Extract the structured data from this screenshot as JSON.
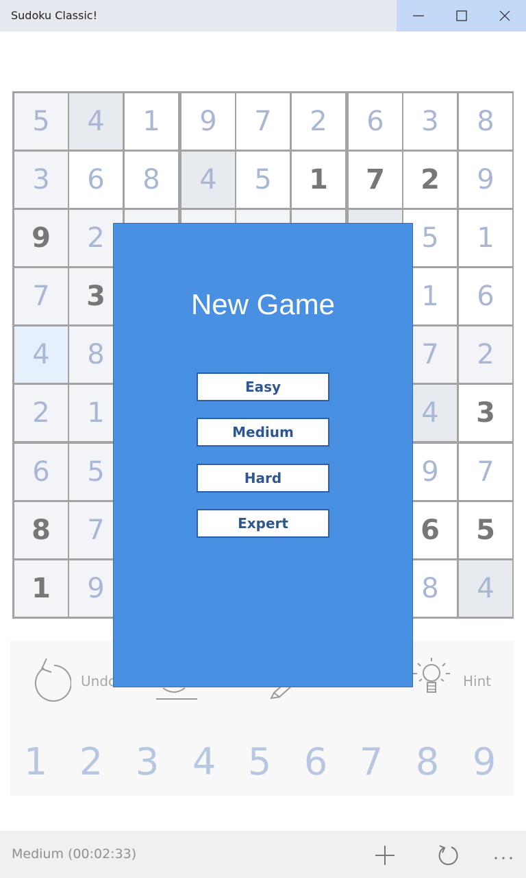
{
  "window": {
    "title": "Sudoku Classic!"
  },
  "board": {
    "rows": [
      [
        "5",
        "4",
        "1",
        "9",
        "7",
        "2",
        "6",
        "3",
        "8"
      ],
      [
        "3",
        "6",
        "8",
        "4",
        "5",
        "1",
        "7",
        "2",
        "9"
      ],
      [
        "9",
        "2",
        "",
        "",
        "",
        "",
        "",
        "5",
        "1"
      ],
      [
        "7",
        "3",
        "",
        "",
        "",
        "",
        "",
        "1",
        "6"
      ],
      [
        "4",
        "8",
        "",
        "",
        "",
        "",
        "",
        "7",
        "2"
      ],
      [
        "2",
        "1",
        "",
        "",
        "",
        "",
        "",
        "4",
        "3"
      ],
      [
        "6",
        "5",
        "",
        "",
        "",
        "",
        "",
        "9",
        "7"
      ],
      [
        "8",
        "7",
        "",
        "",
        "",
        "",
        "",
        "6",
        "5"
      ],
      [
        "1",
        "9",
        "",
        "",
        "",
        "",
        "",
        "8",
        "4"
      ]
    ],
    "given": [
      [
        0,
        0,
        0,
        0,
        0,
        0,
        0,
        0,
        0
      ],
      [
        0,
        0,
        0,
        0,
        0,
        1,
        1,
        1,
        0
      ],
      [
        1,
        0,
        0,
        0,
        0,
        0,
        0,
        0,
        0
      ],
      [
        0,
        1,
        0,
        0,
        0,
        0,
        0,
        0,
        0
      ],
      [
        0,
        0,
        0,
        0,
        0,
        0,
        0,
        0,
        0
      ],
      [
        0,
        0,
        0,
        0,
        0,
        0,
        0,
        0,
        1
      ],
      [
        0,
        0,
        0,
        0,
        0,
        0,
        0,
        0,
        0
      ],
      [
        1,
        0,
        0,
        0,
        0,
        0,
        0,
        1,
        1
      ],
      [
        1,
        0,
        0,
        0,
        0,
        0,
        0,
        0,
        0
      ]
    ],
    "shade": [
      [
        1,
        2,
        0,
        0,
        0,
        0,
        0,
        0,
        0
      ],
      [
        1,
        0,
        0,
        2,
        0,
        0,
        0,
        0,
        0
      ],
      [
        1,
        1,
        1,
        1,
        1,
        1,
        2,
        0,
        0
      ],
      [
        1,
        1,
        0,
        0,
        0,
        0,
        0,
        0,
        0
      ],
      [
        3,
        1,
        0,
        0,
        0,
        0,
        0,
        1,
        1
      ],
      [
        1,
        1,
        0,
        0,
        0,
        0,
        0,
        2,
        0
      ],
      [
        1,
        1,
        0,
        0,
        0,
        0,
        0,
        0,
        0
      ],
      [
        1,
        1,
        0,
        0,
        0,
        0,
        0,
        0,
        0
      ],
      [
        1,
        1,
        0,
        0,
        0,
        0,
        0,
        0,
        2
      ]
    ],
    "shade_colors": [
      "#ffffff",
      "#f3f4f7",
      "#e7eaef",
      "#e6f0fc"
    ]
  },
  "toolbar": {
    "undo_label": "Undo",
    "hint_label": "Hint",
    "number_keys": [
      "1",
      "2",
      "3",
      "4",
      "5",
      "6",
      "7",
      "8",
      "9"
    ]
  },
  "status": {
    "text": "Medium (00:02:33)"
  },
  "dialog": {
    "title": "New Game",
    "options": [
      "Easy",
      "Medium",
      "Hard",
      "Expert"
    ]
  },
  "colors": {
    "accent": "#4a90e2",
    "given_digit": "#777777",
    "entry_digit": "#a9b7d4"
  }
}
